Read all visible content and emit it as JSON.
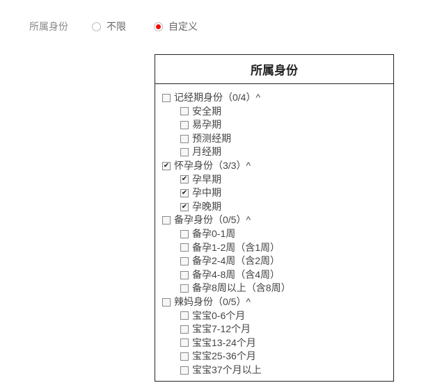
{
  "field_label": "所属身份",
  "radio": {
    "option_unlimited": "不限",
    "option_custom": "自定义",
    "selected": "custom"
  },
  "panel": {
    "title": "所属身份",
    "groups": [
      {
        "label": "记经期身份",
        "count": "（0/4）",
        "caret": "^",
        "checked": false,
        "children": [
          {
            "label": "安全期",
            "checked": false
          },
          {
            "label": "易孕期",
            "checked": false
          },
          {
            "label": "预测经期",
            "checked": false
          },
          {
            "label": "月经期",
            "checked": false
          }
        ]
      },
      {
        "label": "怀孕身份",
        "count": "（3/3）",
        "caret": "^",
        "checked": true,
        "children": [
          {
            "label": "孕早期",
            "checked": true
          },
          {
            "label": "孕中期",
            "checked": true
          },
          {
            "label": "孕晚期",
            "checked": true
          }
        ]
      },
      {
        "label": "备孕身份",
        "count": "（0/5）",
        "caret": "^",
        "checked": false,
        "children": [
          {
            "label": "备孕0-1周",
            "checked": false
          },
          {
            "label": "备孕1-2周（含1周）",
            "checked": false
          },
          {
            "label": "备孕2-4周（含2周）",
            "checked": false
          },
          {
            "label": "备孕4-8周（含4周）",
            "checked": false
          },
          {
            "label": "备孕8周以上（含8周）",
            "checked": false
          }
        ]
      },
      {
        "label": "辣妈身份",
        "count": "（0/5）",
        "caret": "^",
        "checked": false,
        "children": [
          {
            "label": "宝宝0-6个月",
            "checked": false
          },
          {
            "label": "宝宝7-12个月",
            "checked": false
          },
          {
            "label": "宝宝13-24个月",
            "checked": false
          },
          {
            "label": "宝宝25-36个月",
            "checked": false
          },
          {
            "label": "宝宝37个月以上",
            "checked": false
          }
        ]
      }
    ]
  }
}
